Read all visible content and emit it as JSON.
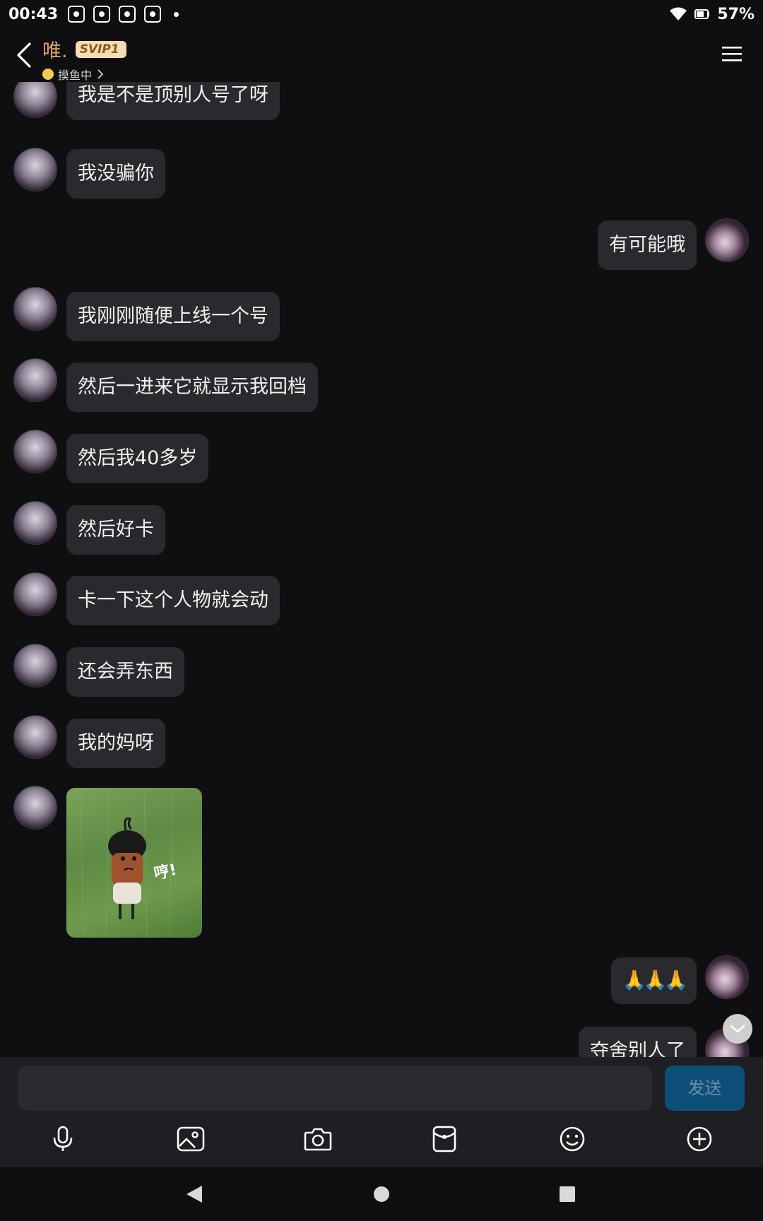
{
  "status_bar": {
    "time": "00:43",
    "battery": "57%"
  },
  "header": {
    "name": "唯.",
    "badge": "SVIP1",
    "status": "摸鱼中"
  },
  "messages": [
    {
      "side": "left",
      "text": "我是不是顶别人号了呀"
    },
    {
      "side": "left",
      "text": "我没骗你"
    },
    {
      "side": "right",
      "text": "有可能哦"
    },
    {
      "side": "left",
      "text": "我刚刚随便上线一个号"
    },
    {
      "side": "left",
      "text": "然后一进来它就显示我回档"
    },
    {
      "side": "left",
      "text": "然后我40多岁"
    },
    {
      "side": "left",
      "text": "然后好卡"
    },
    {
      "side": "left",
      "text": "卡一下这个人物就会动"
    },
    {
      "side": "left",
      "text": "还会弄东西"
    },
    {
      "side": "left",
      "text": "我的妈呀"
    },
    {
      "side": "left",
      "type": "sticker",
      "text": "哼!"
    },
    {
      "side": "right",
      "text": "🙏🙏🙏"
    },
    {
      "side": "right",
      "text": "夺舍别人了"
    }
  ],
  "input": {
    "value": "",
    "send_label": "发送"
  },
  "toolbar": [
    "microphone-icon",
    "image-icon",
    "camera-icon",
    "red-packet-icon",
    "emoji-icon",
    "plus-icon"
  ],
  "colors": {
    "accent": "#d9a460",
    "bubble": "#2a2a2e",
    "send": "#0e4f79",
    "background": "#0f0f12"
  }
}
